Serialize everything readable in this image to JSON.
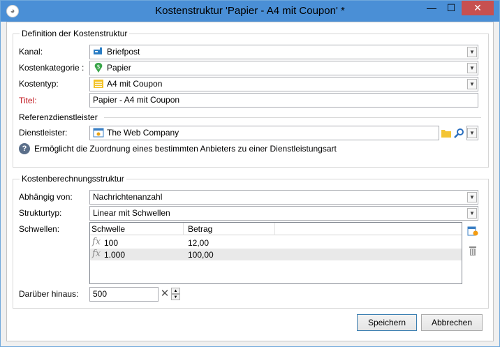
{
  "window": {
    "title": "Kostenstruktur 'Papier - A4 mit Coupon' *",
    "min": "—",
    "max": "☐",
    "close": "✕"
  },
  "definition": {
    "legend": "Definition der Kostenstruktur",
    "kanal_label": "Kanal:",
    "kanal_value": "Briefpost",
    "kostenkategorie_label": "Kostenkategorie :",
    "kostenkategorie_value": "Papier",
    "kostentyp_label": "Kostentyp:",
    "kostentyp_value": "A4 mit Coupon",
    "titel_label": "Titel:",
    "titel_value": "Papier - A4 mit Coupon",
    "referenz_heading": "Referenzdienstleister",
    "dienstleister_label": "Dienstleister:",
    "dienstleister_value": "The Web Company",
    "help_text": "Ermöglicht die Zuordnung eines bestimmten Anbieters zu einer Dienstleistungsart"
  },
  "berechnung": {
    "legend": "Kostenberechnungsstruktur",
    "abhaengig_label": "Abhängig von:",
    "abhaengig_value": "Nachrichtenanzahl",
    "strukturtyp_label": "Strukturtyp:",
    "strukturtyp_value": "Linear mit Schwellen",
    "schwellen_label": "Schwellen:",
    "columns": [
      "Schwelle",
      "Betrag"
    ],
    "rows": [
      {
        "schwelle": "100",
        "betrag": "12,00"
      },
      {
        "schwelle": "1.000",
        "betrag": "100,00"
      }
    ],
    "darueber_label": "Darüber hinaus:",
    "darueber_value": "500"
  },
  "buttons": {
    "save": "Speichern",
    "cancel": "Abbrechen"
  },
  "colors": {
    "titlebar": "#4a8fd6",
    "close": "#c75050",
    "required_label": "#c0151d"
  }
}
